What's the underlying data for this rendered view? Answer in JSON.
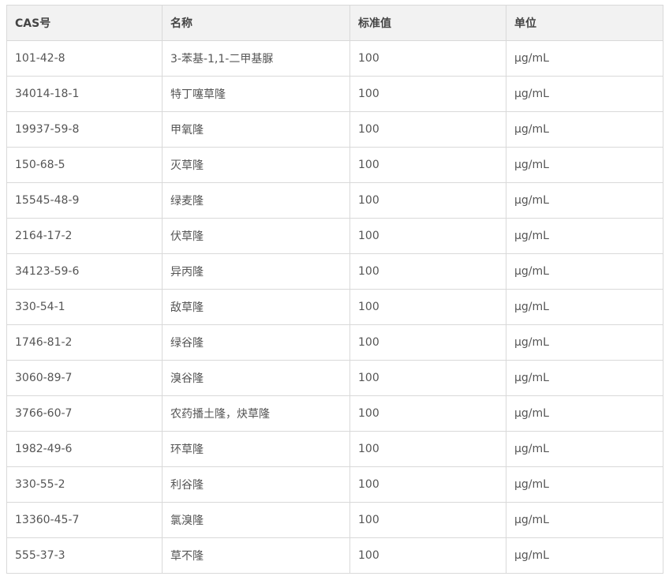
{
  "table": {
    "headers": [
      "CAS号",
      "名称",
      "标准值",
      "单位"
    ],
    "rows": [
      [
        "101-42-8",
        "3-苯基-1,1-二甲基脲",
        "100",
        "μg/mL"
      ],
      [
        "34014-18-1",
        "特丁噻草隆",
        "100",
        "μg/mL"
      ],
      [
        "19937-59-8",
        "甲氧隆",
        "100",
        "μg/mL"
      ],
      [
        "150-68-5",
        "灭草隆",
        "100",
        "μg/mL"
      ],
      [
        "15545-48-9",
        "绿麦隆",
        "100",
        "μg/mL"
      ],
      [
        "2164-17-2",
        "伏草隆",
        "100",
        "μg/mL"
      ],
      [
        "34123-59-6",
        "异丙隆",
        "100",
        "μg/mL"
      ],
      [
        "330-54-1",
        "敌草隆",
        "100",
        "μg/mL"
      ],
      [
        "1746-81-2",
        "绿谷隆",
        "100",
        "μg/mL"
      ],
      [
        "3060-89-7",
        "溴谷隆",
        "100",
        "μg/mL"
      ],
      [
        "3766-60-7",
        "农药播土隆，炔草隆",
        "100",
        "μg/mL"
      ],
      [
        "1982-49-6",
        "环草隆",
        "100",
        "μg/mL"
      ],
      [
        "330-55-2",
        "利谷隆",
        "100",
        "μg/mL"
      ],
      [
        "13360-45-7",
        "氯溴隆",
        "100",
        "μg/mL"
      ],
      [
        "555-37-3",
        "草不隆",
        "100",
        "μg/mL"
      ]
    ]
  }
}
